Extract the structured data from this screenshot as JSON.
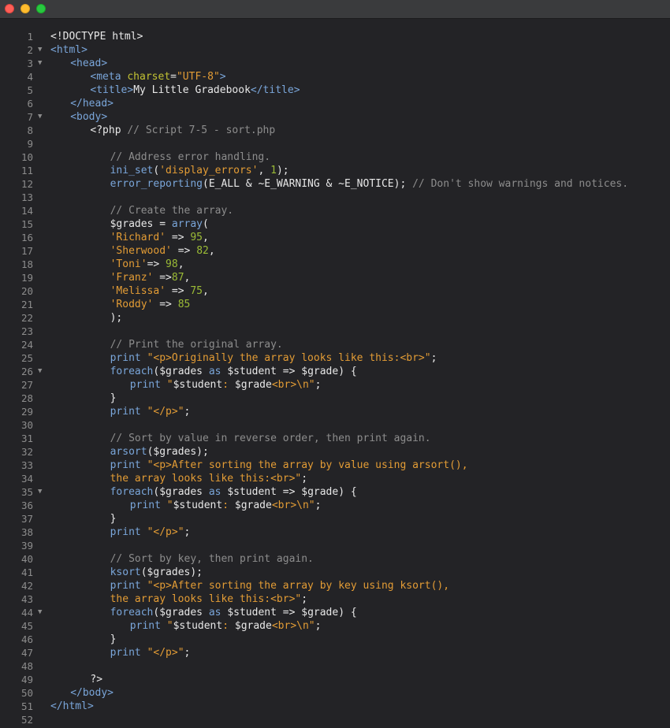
{
  "window": {
    "controls": [
      "close-button",
      "minimize-button",
      "maximize-button"
    ]
  },
  "colors": {
    "plain": "#e8e8e8",
    "tag": "#7aa6da",
    "attr": "#c2c233",
    "str": "#e39c35",
    "com": "#8d8d8d",
    "func": "#7aa6da",
    "num": "#9bbb36"
  },
  "lines": [
    {
      "n": "1",
      "fold": false,
      "indent": 0,
      "t": [
        [
          "plain",
          "<!DOCTYPE html>"
        ]
      ]
    },
    {
      "n": "2",
      "fold": true,
      "indent": 0,
      "t": [
        [
          "tag",
          "<html>"
        ]
      ]
    },
    {
      "n": "3",
      "fold": true,
      "indent": 1,
      "t": [
        [
          "tag",
          "<head>"
        ]
      ]
    },
    {
      "n": "4",
      "fold": false,
      "indent": 2,
      "t": [
        [
          "tag",
          "<meta "
        ],
        [
          "attr",
          "charset"
        ],
        [
          "plain",
          "="
        ],
        [
          "str",
          "\"UTF-8\""
        ],
        [
          "tag",
          ">"
        ]
      ]
    },
    {
      "n": "5",
      "fold": false,
      "indent": 2,
      "t": [
        [
          "tag",
          "<title>"
        ],
        [
          "plain",
          "My Little Gradebook"
        ],
        [
          "tag",
          "</title>"
        ]
      ]
    },
    {
      "n": "6",
      "fold": false,
      "indent": 1,
      "t": [
        [
          "tag",
          "</head>"
        ]
      ]
    },
    {
      "n": "7",
      "fold": true,
      "indent": 1,
      "t": [
        [
          "tag",
          "<body>"
        ]
      ]
    },
    {
      "n": "8",
      "fold": false,
      "indent": 2,
      "t": [
        [
          "plain",
          "<?php "
        ],
        [
          "com",
          "// Script 7-5 - sort.php"
        ]
      ]
    },
    {
      "n": "9",
      "fold": false,
      "indent": 0,
      "t": []
    },
    {
      "n": "10",
      "fold": false,
      "indent": 3,
      "t": [
        [
          "com",
          "// Address error handling."
        ]
      ]
    },
    {
      "n": "11",
      "fold": false,
      "indent": 3,
      "t": [
        [
          "func",
          "ini_set"
        ],
        [
          "plain",
          "("
        ],
        [
          "str",
          "'display_errors'"
        ],
        [
          "plain",
          ", "
        ],
        [
          "num",
          "1"
        ],
        [
          "plain",
          ");"
        ]
      ]
    },
    {
      "n": "12",
      "fold": false,
      "indent": 3,
      "t": [
        [
          "func",
          "error_reporting"
        ],
        [
          "plain",
          "(E_ALL & ~E_WARNING & ~E_NOTICE); "
        ],
        [
          "com",
          "// Don't show warnings and notices."
        ]
      ]
    },
    {
      "n": "13",
      "fold": false,
      "indent": 0,
      "t": []
    },
    {
      "n": "14",
      "fold": false,
      "indent": 3,
      "t": [
        [
          "com",
          "// Create the array."
        ]
      ]
    },
    {
      "n": "15",
      "fold": false,
      "indent": 3,
      "t": [
        [
          "plain",
          "$grades = "
        ],
        [
          "func",
          "array"
        ],
        [
          "plain",
          "("
        ]
      ]
    },
    {
      "n": "16",
      "fold": false,
      "indent": 3,
      "t": [
        [
          "str",
          "'Richard'"
        ],
        [
          "plain",
          " => "
        ],
        [
          "num",
          "95"
        ],
        [
          "plain",
          ","
        ]
      ]
    },
    {
      "n": "17",
      "fold": false,
      "indent": 3,
      "t": [
        [
          "str",
          "'Sherwood'"
        ],
        [
          "plain",
          " => "
        ],
        [
          "num",
          "82"
        ],
        [
          "plain",
          ","
        ]
      ]
    },
    {
      "n": "18",
      "fold": false,
      "indent": 3,
      "t": [
        [
          "str",
          "'Toni'"
        ],
        [
          "plain",
          "=> "
        ],
        [
          "num",
          "98"
        ],
        [
          "plain",
          ","
        ]
      ]
    },
    {
      "n": "19",
      "fold": false,
      "indent": 3,
      "t": [
        [
          "str",
          "'Franz'"
        ],
        [
          "plain",
          " =>"
        ],
        [
          "num",
          "87"
        ],
        [
          "plain",
          ","
        ]
      ]
    },
    {
      "n": "20",
      "fold": false,
      "indent": 3,
      "t": [
        [
          "str",
          "'Melissa'"
        ],
        [
          "plain",
          " => "
        ],
        [
          "num",
          "75"
        ],
        [
          "plain",
          ","
        ]
      ]
    },
    {
      "n": "21",
      "fold": false,
      "indent": 3,
      "t": [
        [
          "str",
          "'Roddy'"
        ],
        [
          "plain",
          " => "
        ],
        [
          "num",
          "85"
        ]
      ]
    },
    {
      "n": "22",
      "fold": false,
      "indent": 3,
      "t": [
        [
          "plain",
          ");"
        ]
      ]
    },
    {
      "n": "23",
      "fold": false,
      "indent": 0,
      "t": []
    },
    {
      "n": "24",
      "fold": false,
      "indent": 3,
      "t": [
        [
          "com",
          "// Print the original array."
        ]
      ]
    },
    {
      "n": "25",
      "fold": false,
      "indent": 3,
      "t": [
        [
          "func",
          "print"
        ],
        [
          "plain",
          " "
        ],
        [
          "str",
          "\"<p>Originally the array looks like this:<br>\""
        ],
        [
          "plain",
          ";"
        ]
      ]
    },
    {
      "n": "26",
      "fold": true,
      "indent": 3,
      "t": [
        [
          "func",
          "foreach"
        ],
        [
          "plain",
          "($grades "
        ],
        [
          "func",
          "as"
        ],
        [
          "plain",
          " $student => $grade) {"
        ]
      ]
    },
    {
      "n": "27",
      "fold": false,
      "indent": 4,
      "t": [
        [
          "func",
          "print"
        ],
        [
          "plain",
          " "
        ],
        [
          "str",
          "\""
        ],
        [
          "plain",
          "$student"
        ],
        [
          "str",
          ": "
        ],
        [
          "plain",
          "$grade"
        ],
        [
          "str",
          "<br>\\n\""
        ],
        [
          "plain",
          ";"
        ]
      ]
    },
    {
      "n": "28",
      "fold": false,
      "indent": 3,
      "t": [
        [
          "plain",
          "}"
        ]
      ]
    },
    {
      "n": "29",
      "fold": false,
      "indent": 3,
      "t": [
        [
          "func",
          "print"
        ],
        [
          "plain",
          " "
        ],
        [
          "str",
          "\"</p>\""
        ],
        [
          "plain",
          ";"
        ]
      ]
    },
    {
      "n": "30",
      "fold": false,
      "indent": 0,
      "t": []
    },
    {
      "n": "31",
      "fold": false,
      "indent": 3,
      "t": [
        [
          "com",
          "// Sort by value in reverse order, then print again."
        ]
      ]
    },
    {
      "n": "32",
      "fold": false,
      "indent": 3,
      "t": [
        [
          "func",
          "arsort"
        ],
        [
          "plain",
          "($grades);"
        ]
      ]
    },
    {
      "n": "33",
      "fold": false,
      "indent": 3,
      "t": [
        [
          "func",
          "print"
        ],
        [
          "plain",
          " "
        ],
        [
          "str",
          "\"<p>After sorting the array by value using arsort(),"
        ]
      ]
    },
    {
      "n": "34",
      "fold": false,
      "indent": 3,
      "t": [
        [
          "str",
          "the array looks like this:<br>\""
        ],
        [
          "plain",
          ";"
        ]
      ]
    },
    {
      "n": "35",
      "fold": true,
      "indent": 3,
      "t": [
        [
          "func",
          "foreach"
        ],
        [
          "plain",
          "($grades "
        ],
        [
          "func",
          "as"
        ],
        [
          "plain",
          " $student => $grade) {"
        ]
      ]
    },
    {
      "n": "36",
      "fold": false,
      "indent": 4,
      "t": [
        [
          "func",
          "print"
        ],
        [
          "plain",
          " "
        ],
        [
          "str",
          "\""
        ],
        [
          "plain",
          "$student"
        ],
        [
          "str",
          ": "
        ],
        [
          "plain",
          "$grade"
        ],
        [
          "str",
          "<br>\\n\""
        ],
        [
          "plain",
          ";"
        ]
      ]
    },
    {
      "n": "37",
      "fold": false,
      "indent": 3,
      "t": [
        [
          "plain",
          "}"
        ]
      ]
    },
    {
      "n": "38",
      "fold": false,
      "indent": 3,
      "t": [
        [
          "func",
          "print"
        ],
        [
          "plain",
          " "
        ],
        [
          "str",
          "\"</p>\""
        ],
        [
          "plain",
          ";"
        ]
      ]
    },
    {
      "n": "39",
      "fold": false,
      "indent": 0,
      "t": []
    },
    {
      "n": "40",
      "fold": false,
      "indent": 3,
      "t": [
        [
          "com",
          "// Sort by key, then print again."
        ]
      ]
    },
    {
      "n": "41",
      "fold": false,
      "indent": 3,
      "t": [
        [
          "func",
          "ksort"
        ],
        [
          "plain",
          "($grades);"
        ]
      ]
    },
    {
      "n": "42",
      "fold": false,
      "indent": 3,
      "t": [
        [
          "func",
          "print"
        ],
        [
          "plain",
          " "
        ],
        [
          "str",
          "\"<p>After sorting the array by key using ksort(),"
        ]
      ]
    },
    {
      "n": "43",
      "fold": false,
      "indent": 3,
      "t": [
        [
          "str",
          "the array looks like this:<br>\""
        ],
        [
          "plain",
          ";"
        ]
      ]
    },
    {
      "n": "44",
      "fold": true,
      "indent": 3,
      "t": [
        [
          "func",
          "foreach"
        ],
        [
          "plain",
          "($grades "
        ],
        [
          "func",
          "as"
        ],
        [
          "plain",
          " $student => $grade) {"
        ]
      ]
    },
    {
      "n": "45",
      "fold": false,
      "indent": 4,
      "t": [
        [
          "func",
          "print"
        ],
        [
          "plain",
          " "
        ],
        [
          "str",
          "\""
        ],
        [
          "plain",
          "$student"
        ],
        [
          "str",
          ": "
        ],
        [
          "plain",
          "$grade"
        ],
        [
          "str",
          "<br>\\n\""
        ],
        [
          "plain",
          ";"
        ]
      ]
    },
    {
      "n": "46",
      "fold": false,
      "indent": 3,
      "t": [
        [
          "plain",
          "}"
        ]
      ]
    },
    {
      "n": "47",
      "fold": false,
      "indent": 3,
      "t": [
        [
          "func",
          "print"
        ],
        [
          "plain",
          " "
        ],
        [
          "str",
          "\"</p>\""
        ],
        [
          "plain",
          ";"
        ]
      ]
    },
    {
      "n": "48",
      "fold": false,
      "indent": 0,
      "t": []
    },
    {
      "n": "49",
      "fold": false,
      "indent": 2,
      "t": [
        [
          "plain",
          "?>"
        ]
      ]
    },
    {
      "n": "50",
      "fold": false,
      "indent": 1,
      "t": [
        [
          "tag",
          "</body>"
        ]
      ]
    },
    {
      "n": "51",
      "fold": false,
      "indent": 0,
      "t": [
        [
          "tag",
          "</html>"
        ]
      ]
    },
    {
      "n": "52",
      "fold": false,
      "indent": 0,
      "t": []
    }
  ]
}
